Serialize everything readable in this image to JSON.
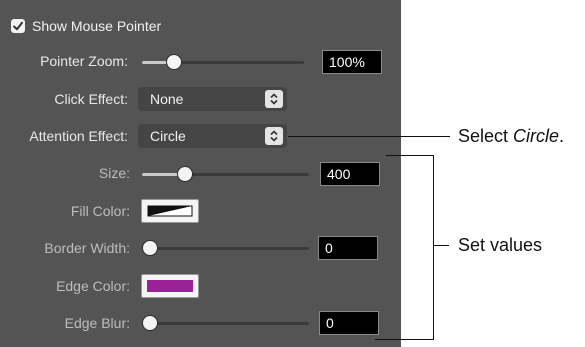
{
  "show_mouse_pointer": {
    "label": "Show Mouse Pointer",
    "checked": true
  },
  "pointer_zoom": {
    "label": "Pointer Zoom:",
    "value": "100%",
    "level": 0.2
  },
  "click_effect": {
    "label": "Click Effect:",
    "value": "None"
  },
  "attention_effect": {
    "label": "Attention Effect:",
    "value": "Circle"
  },
  "size": {
    "label": "Size:",
    "value": "400",
    "level": 0.26
  },
  "fill_color": {
    "label": "Fill Color:"
  },
  "border_width": {
    "label": "Border Width:",
    "value": "0",
    "level": 0.0
  },
  "edge_color": {
    "label": "Edge Color:",
    "color": "#9b2196"
  },
  "edge_blur": {
    "label": "Edge Blur:",
    "value": "0",
    "level": 0.0
  },
  "annotations": {
    "select_prefix": "Select ",
    "select_em": "Circle",
    "select_suffix": ".",
    "set_values": "Set values"
  },
  "colors": {
    "panel": "#545454",
    "field": "#000000",
    "accent_purple": "#9b2196"
  }
}
